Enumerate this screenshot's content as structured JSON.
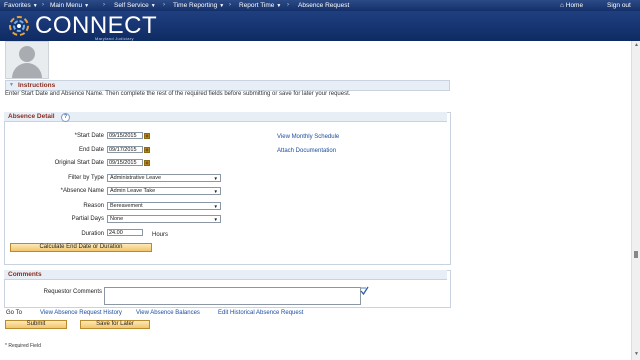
{
  "topnav": {
    "favorites": "Favorites",
    "main_menu": "Main Menu",
    "self_service": "Self Service",
    "time_reporting": "Time Reporting",
    "report_time": "Report Time",
    "absence_request": "Absence Request",
    "home": "Home",
    "sign_out": "Sign out"
  },
  "banner": {
    "logo": "CONNECT",
    "subtitle": "Maryland Judiciary"
  },
  "instructions": {
    "title": "Instructions",
    "text": "Enter Start Date and Absence Name. Then complete the rest of the required fields before submitting or save for later your request."
  },
  "absence_detail": {
    "title": "Absence Detail",
    "start_date_label": "*Start Date",
    "start_date": "09/15/2015",
    "end_date_label": "End Date",
    "end_date": "09/17/2015",
    "original_start_label": "Original Start Date",
    "original_start": "09/15/2015",
    "filter_label": "Filter by Type",
    "filter_value": "Administrative Leave",
    "absence_name_label": "*Absence Name",
    "absence_name_value": "Admin Leave Take",
    "reason_label": "Reason",
    "reason_value": "Bereavement",
    "partial_label": "Partial Days",
    "partial_value": "None",
    "duration_label": "Duration",
    "duration_value": "24.00",
    "duration_unit": "Hours",
    "calculate_button": "Calculate End Date or Duration",
    "view_monthly": "View Monthly Schedule",
    "attach_doc": "Attach Documentation"
  },
  "comments": {
    "title": "Comments",
    "requestor_label": "Requestor Comments"
  },
  "goto": {
    "label": "Go To",
    "history": "View Absence Request History",
    "balances": "View Absence Balances",
    "edit_historical": "Edit Historical Absence Request"
  },
  "actions": {
    "submit": "Submit",
    "save_later": "Save for Later"
  },
  "footer": {
    "required_note": "* Required Field"
  }
}
